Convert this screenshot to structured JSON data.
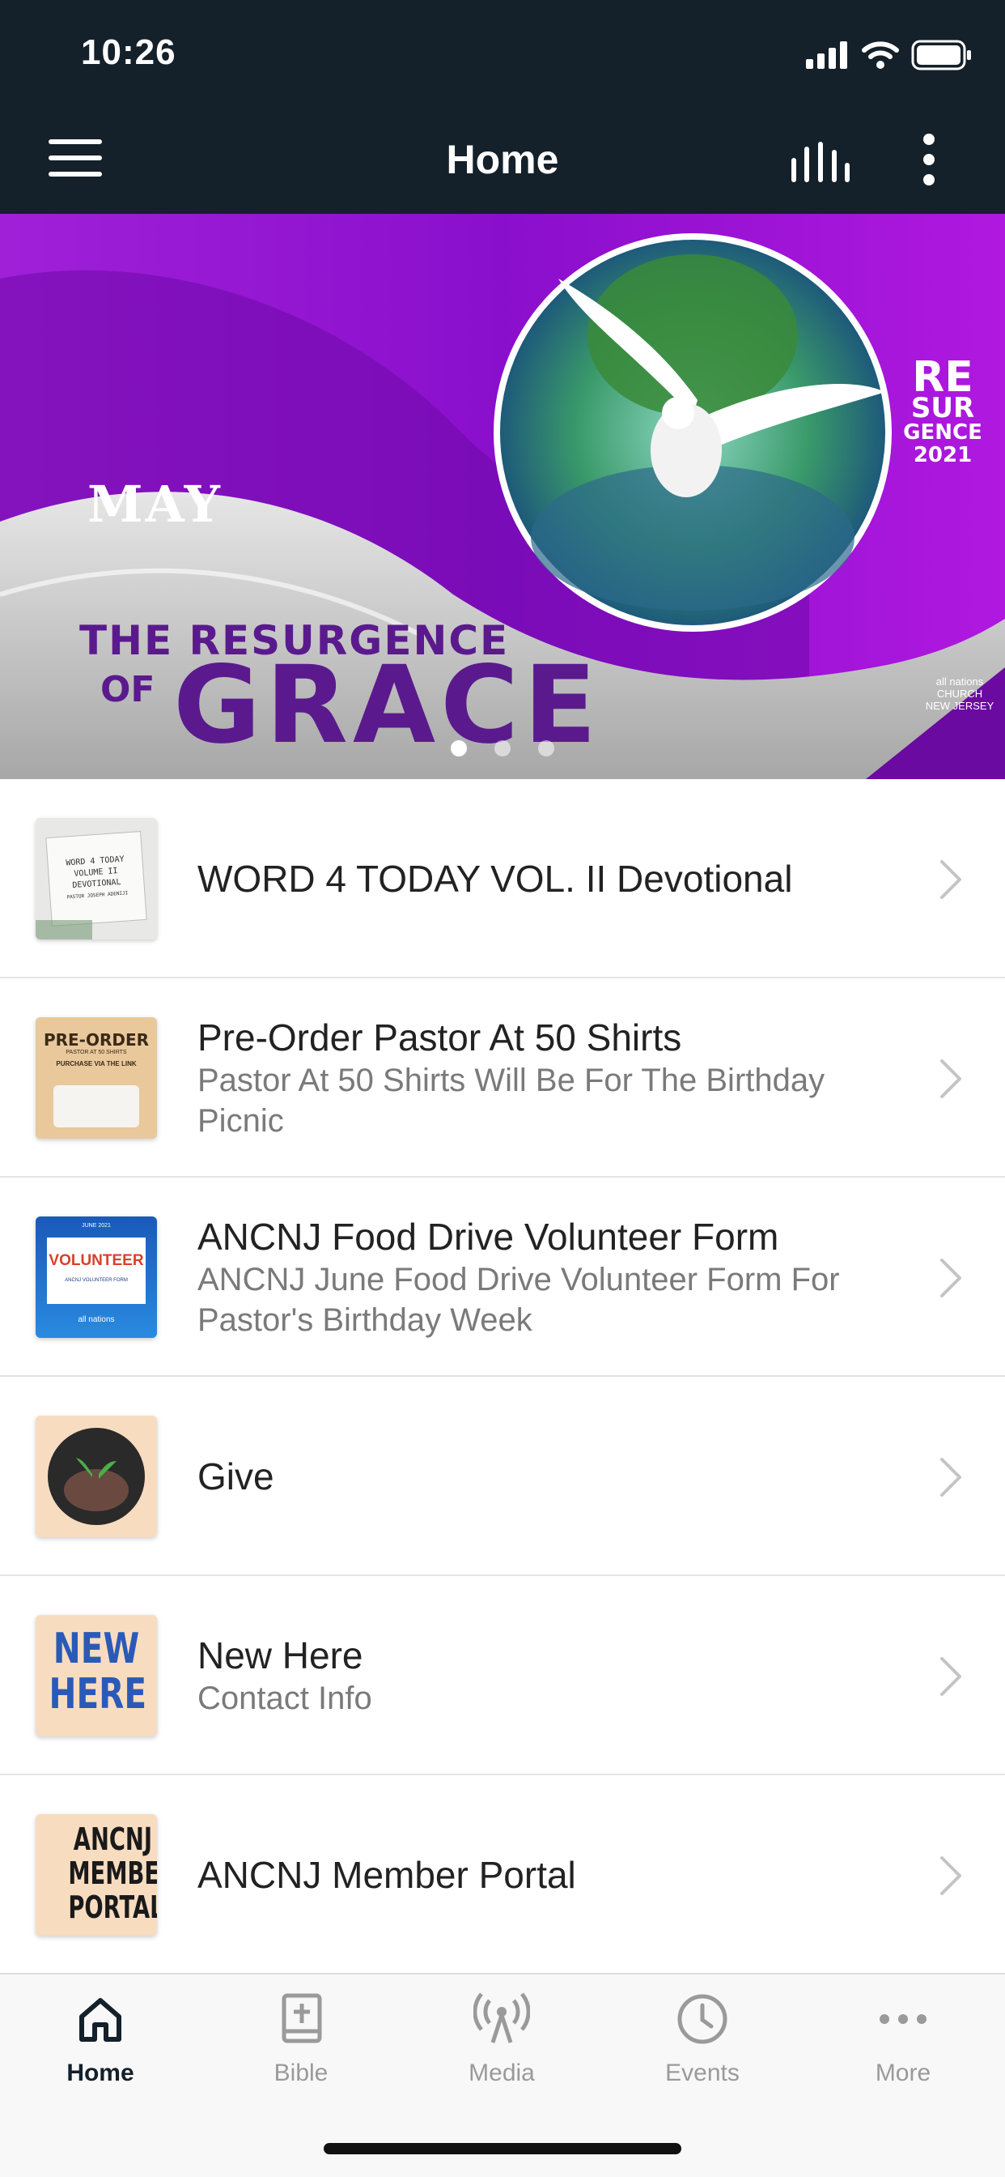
{
  "status": {
    "time": "10:26"
  },
  "header": {
    "title": "Home"
  },
  "banner": {
    "month": "MAY",
    "title_line1": "THE RESURGENCE",
    "title_of": "OF",
    "title_main": "GRACE",
    "logo_line1": "RE",
    "logo_line2": "SUR",
    "logo_line3": "GENCE",
    "logo_year": "2021",
    "church_name": "all nations",
    "church_sub1": "CHURCH",
    "church_sub2": "NEW JERSEY",
    "colors": {
      "purple": "#8a10c8",
      "dark_purple": "#5a1a8e"
    }
  },
  "list": {
    "items": [
      {
        "title": "WORD 4 TODAY VOL. II Devotional",
        "subtitle": "",
        "thumb": {
          "line1": "WORD 4 TODAY",
          "line2": "VOLUME II",
          "line3": "DEVOTIONAL",
          "line4": "PASTOR JOSEPH ADENIJI"
        }
      },
      {
        "title": "Pre-Order Pastor At 50 Shirts",
        "subtitle": "Pastor At 50 Shirts Will Be For The Birthday Picnic",
        "thumb": {
          "line1": "PRE-ORDER",
          "line2": "PASTOR AT 50 SHIRTS",
          "line3": "PURCHASE VIA THE LINK"
        }
      },
      {
        "title": "ANCNJ Food Drive Volunteer Form",
        "subtitle": "ANCNJ June Food Drive Volunteer Form For Pastor's Birthday Week",
        "thumb": {
          "line1": "JUNE 2021",
          "line2": "VOLUNTEER",
          "line3": "ANCNJ VOLUNTEER FORM",
          "line4": "all nations"
        }
      },
      {
        "title": "Give",
        "subtitle": "",
        "thumb": {
          "icon": "seedling-hands-icon"
        }
      },
      {
        "title": "New Here",
        "subtitle": "Contact Info",
        "thumb": {
          "line1": "NEW",
          "line2": "HERE"
        }
      },
      {
        "title": "ANCNJ Member Portal",
        "subtitle": "",
        "thumb": {
          "line1": "ANCNJ",
          "line2": "MEMBER",
          "line3": "PORTAL"
        }
      }
    ]
  },
  "tabs": [
    {
      "label": "Home",
      "icon": "home-icon",
      "active": true
    },
    {
      "label": "Bible",
      "icon": "bible-icon",
      "active": false
    },
    {
      "label": "Media",
      "icon": "broadcast-icon",
      "active": false
    },
    {
      "label": "Events",
      "icon": "clock-icon",
      "active": false
    },
    {
      "label": "More",
      "icon": "ellipsis-icon",
      "active": false
    }
  ]
}
